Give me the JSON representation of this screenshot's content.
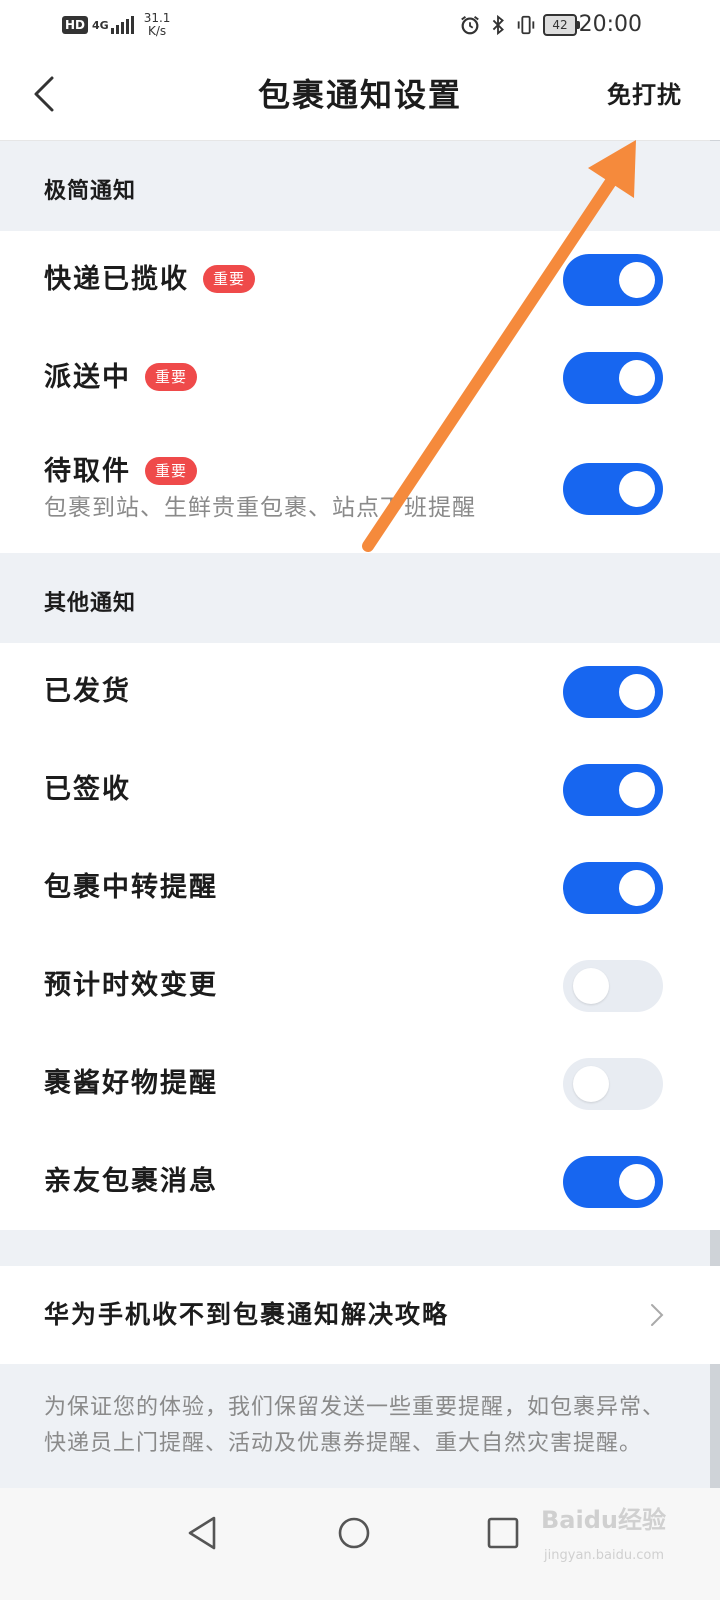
{
  "status_bar": {
    "hd": "HD",
    "network": "4G",
    "speed_value": "31.1",
    "speed_unit": "K/s",
    "battery": "42",
    "time": "20:00",
    "icons": [
      "alarm-icon",
      "bluetooth-icon",
      "vibrate-icon",
      "battery-icon"
    ]
  },
  "header": {
    "title": "包裹通知设置",
    "right_action": "免打扰",
    "back_icon": "back-chevron-icon"
  },
  "sections": [
    {
      "title": "极简通知",
      "items": [
        {
          "label": "快递已揽收",
          "badge": "重要",
          "subtitle": "",
          "enabled": true
        },
        {
          "label": "派送中",
          "badge": "重要",
          "subtitle": "",
          "enabled": true
        },
        {
          "label": "待取件",
          "badge": "重要",
          "subtitle": "包裹到站、生鲜贵重包裹、站点下班提醒",
          "enabled": true
        }
      ]
    },
    {
      "title": "其他通知",
      "items": [
        {
          "label": "已发货",
          "enabled": true
        },
        {
          "label": "已签收",
          "enabled": true
        },
        {
          "label": "包裹中转提醒",
          "enabled": true
        },
        {
          "label": "预计时效变更",
          "enabled": false
        },
        {
          "label": "裹酱好物提醒",
          "enabled": false
        },
        {
          "label": "亲友包裹消息",
          "enabled": true
        }
      ]
    }
  ],
  "guide_link": {
    "label": "华为手机收不到包裹通知解决攻略",
    "icon": "chevron-right-icon"
  },
  "disclaimer": "为保证您的体验，我们保留发送一些重要提醒，如包裹异常、快递员上门提醒、活动及优惠券提醒、重大自然灾害提醒。",
  "system_nav": {
    "icons": [
      "nav-back-icon",
      "nav-home-icon",
      "nav-recents-icon"
    ]
  },
  "watermark": {
    "main": "Baidu经验",
    "sub": "jingyan.baidu.com"
  },
  "colors": {
    "toggle_on": "#1766f0",
    "toggle_off": "#e8ecf2",
    "badge": "#ef4a4a",
    "annotation_arrow": "#f58a3c",
    "page_bg": "#eef1f5"
  }
}
